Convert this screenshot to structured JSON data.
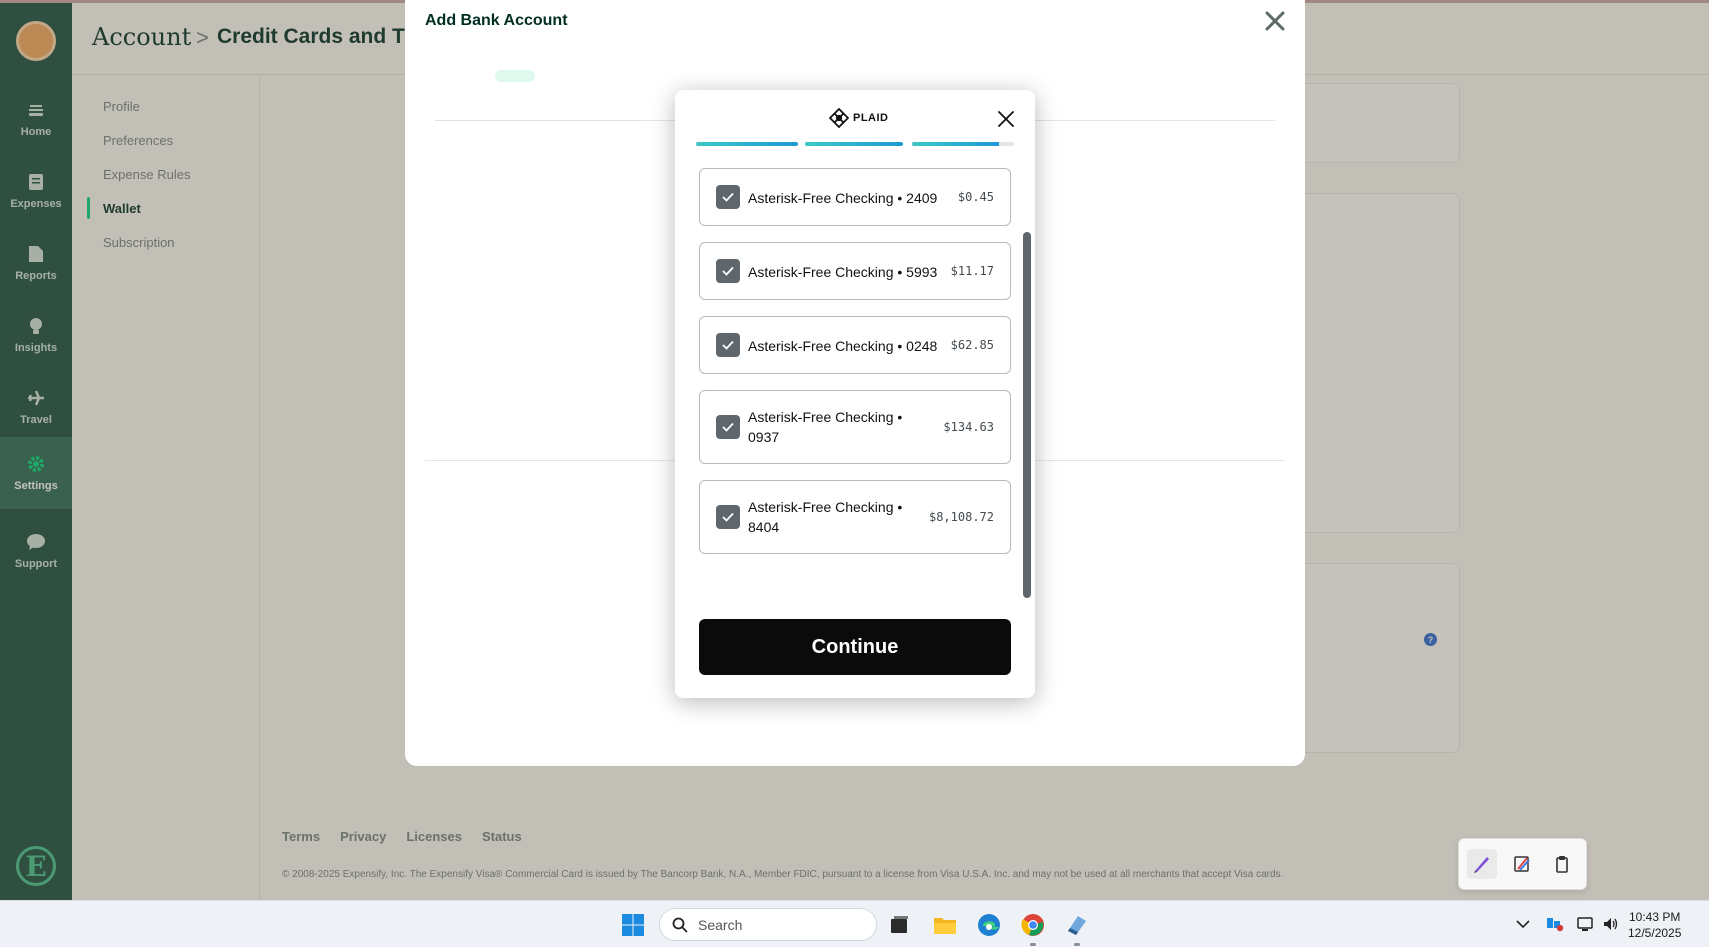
{
  "app": {
    "breadcrumb": {
      "root": "Account",
      "separator": ">",
      "current": "Credit Cards and Tr"
    },
    "sidebar": [
      {
        "label": "Home",
        "icon": "home-icon"
      },
      {
        "label": "Expenses",
        "icon": "receipt-icon"
      },
      {
        "label": "Reports",
        "icon": "document-icon"
      },
      {
        "label": "Insights",
        "icon": "lightbulb-icon"
      },
      {
        "label": "Travel",
        "icon": "plane-icon"
      },
      {
        "label": "Settings",
        "icon": "gear-icon",
        "active": true
      },
      {
        "label": "Support",
        "icon": "chat-bubble-icon"
      }
    ],
    "settings_nav": [
      {
        "label": "Profile"
      },
      {
        "label": "Preferences"
      },
      {
        "label": "Expense Rules"
      },
      {
        "label": "Wallet",
        "active": true
      },
      {
        "label": "Subscription"
      }
    ],
    "footer": {
      "links": [
        "Terms",
        "Privacy",
        "Licenses",
        "Status"
      ],
      "legal": "© 2008-2025 Expensify, Inc. The Expensify Visa® Commercial Card is issued by The Bancorp Bank, N.A., Member FDIC, pursuant to a license from Visa U.S.A. Inc. and may not be used at all merchants that accept Visa cards."
    },
    "colors": {
      "sidebar": "#1a4f3f",
      "accent": "#03d47c"
    }
  },
  "bank_modal": {
    "title": "Add Bank Account"
  },
  "plaid": {
    "brand": "PLAID",
    "progress": [
      1.0,
      1.0,
      0.85
    ],
    "accounts": [
      {
        "name": "Asterisk-Free Checking • 2409",
        "balance": "$0.45",
        "checked": true
      },
      {
        "name": "Asterisk-Free Checking • 5993",
        "balance": "$11.17",
        "checked": true
      },
      {
        "name": "Asterisk-Free Checking • 0248",
        "balance": "$62.85",
        "checked": true
      },
      {
        "name": "Asterisk-Free Checking • 0937",
        "balance": "$134.63",
        "checked": true
      },
      {
        "name": "Asterisk-Free Checking • 8404",
        "balance": "$8,108.72",
        "checked": true
      }
    ],
    "continue_label": "Continue"
  },
  "taskbar": {
    "search_placeholder": "Search",
    "time": "10:43 PM",
    "date": "12/5/2025"
  }
}
